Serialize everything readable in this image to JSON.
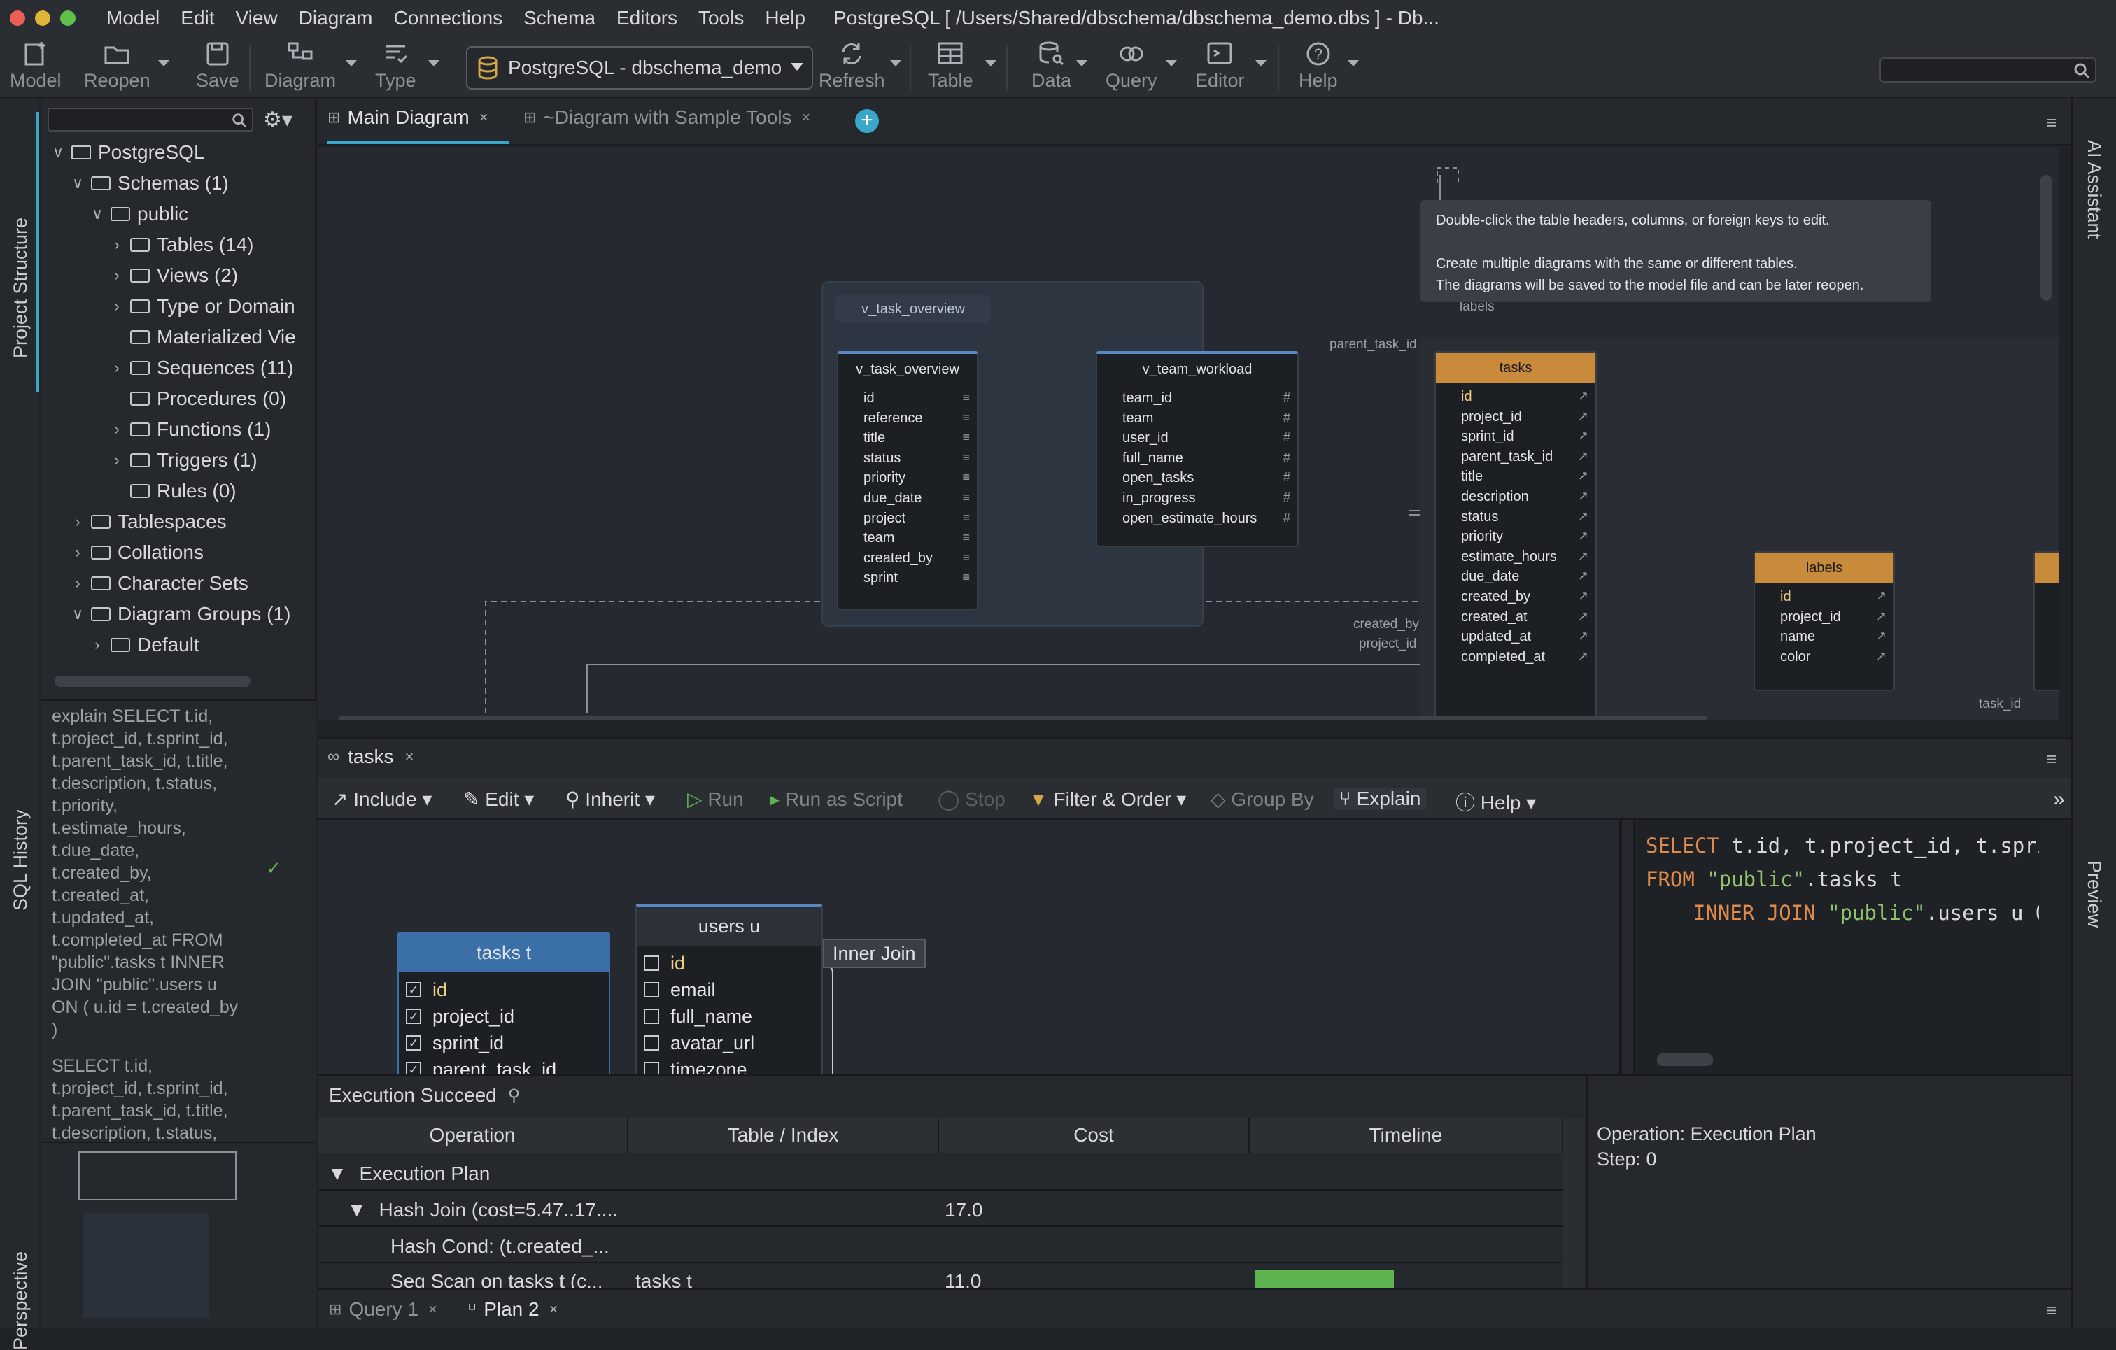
{
  "menubar": {
    "items": [
      "Model",
      "Edit",
      "View",
      "Diagram",
      "Connections",
      "Schema",
      "Editors",
      "Tools",
      "Help"
    ],
    "title": "PostgreSQL [ /Users/Shared/dbschema/dbschema_demo.dbs ] - Db..."
  },
  "toolbar": {
    "model": "Model",
    "reopen": "Reopen",
    "save": "Save",
    "diagram": "Diagram",
    "type": "Type",
    "connection": "PostgreSQL - dbschema_demo",
    "refresh": "Refresh",
    "table": "Table",
    "data": "Data",
    "query": "Query",
    "editor": "Editor",
    "help": "Help"
  },
  "side_tabs": {
    "project_structure": "Project Structure",
    "sql_history": "SQL History",
    "perspective": "Perspective",
    "ai_assistant": "AI Assistant",
    "preview": "Preview"
  },
  "tree": {
    "root": "PostgreSQL",
    "schemas": "Schemas (1)",
    "public": "public",
    "tables": "Tables (14)",
    "views": "Views (2)",
    "types": "Type or Domain",
    "mviews": "Materialized Vie",
    "sequences": "Sequences (11)",
    "procedures": "Procedures (0)",
    "functions": "Functions (1)",
    "triggers": "Triggers (1)",
    "rules": "Rules (0)",
    "tablespaces": "Tablespaces",
    "collations": "Collations",
    "charsets": "Character Sets",
    "diagram_groups": "Diagram Groups (1)",
    "default": "Default"
  },
  "sql_history": {
    "entry1": "explain SELECT t.id,\nt.project_id, t.sprint_id,\nt.parent_task_id, t.title,\nt.description, t.status,\nt.priority,\nt.estimate_hours,\nt.due_date,\nt.created_by,\nt.created_at,\nt.updated_at,\nt.completed_at FROM\n\"public\".tasks t INNER\nJOIN \"public\".users u\nON ( u.id = t.created_by\n)",
    "entry2": "SELECT t.id,\nt.project_id, t.sprint_id,\nt.parent_task_id, t.title,\nt.description, t.status,"
  },
  "diagram_tabs": {
    "main": "Main Diagram",
    "sample": "~Diagram with Sample Tools"
  },
  "canvas": {
    "group_label": "v_task_overview",
    "hint": [
      "Double-click the table headers, columns, or foreign keys to edit.",
      "",
      "Create multiple diagrams with the same or different tables.",
      "The diagrams will be saved to the model file and can be later reopen."
    ],
    "fk_labels": {
      "parent_task_id": "parent_task_id",
      "created_by": "created_by",
      "project_id": "project_id",
      "labels": "labels",
      "task_id": "task_id"
    },
    "v_task_overview": {
      "name": "v_task_overview",
      "columns": [
        "id",
        "reference",
        "title",
        "status",
        "priority",
        "due_date",
        "project",
        "team",
        "created_by",
        "sprint"
      ]
    },
    "v_team_workload": {
      "name": "v_team_workload",
      "columns": [
        "team_id",
        "team",
        "user_id",
        "full_name",
        "open_tasks",
        "in_progress",
        "open_estimate_hours"
      ]
    },
    "tasks": {
      "name": "tasks",
      "columns": [
        "id",
        "project_id",
        "sprint_id",
        "parent_task_id",
        "title",
        "description",
        "status",
        "priority",
        "estimate_hours",
        "due_date",
        "created_by",
        "created_at",
        "updated_at",
        "completed_at"
      ]
    },
    "labels": {
      "name": "labels",
      "columns": [
        "id",
        "project_id",
        "name",
        "color"
      ]
    }
  },
  "query_tab": "tasks",
  "query_toolbar": {
    "include": "Include",
    "edit": "Edit",
    "inherit": "Inherit",
    "run": "Run",
    "run_script": "Run as Script",
    "stop": "Stop",
    "filter": "Filter & Order",
    "group": "Group By",
    "explain": "Explain",
    "help": "Help"
  },
  "builder": {
    "tasks_t": {
      "name": "tasks t",
      "columns": [
        "id",
        "project_id",
        "sprint_id",
        "parent_task_id"
      ]
    },
    "users_u": {
      "name": "users u",
      "columns": [
        "id",
        "email",
        "full_name",
        "avatar_url",
        "timezone"
      ]
    },
    "join": "Inner Join"
  },
  "sql": {
    "kw1": "SELECT",
    "l1": " t.id, t.project_id, t.spri",
    "kw2": "FROM",
    "s2": " \"public\"",
    "l2": ".tasks t",
    "kw3": "INNER JOIN",
    "s3": " \"public\"",
    "l3": ".users u O"
  },
  "results": {
    "status": "Execution Succeed",
    "headers": [
      "Operation",
      "Table / Index",
      "Cost",
      "Timeline"
    ],
    "rows": [
      {
        "op": "Execution Plan",
        "table": "",
        "cost": ""
      },
      {
        "op": "Hash Join  (cost=5.47..17....",
        "table": "",
        "cost": "17.0"
      },
      {
        "op": "Hash Cond: (t.created_...",
        "table": "",
        "cost": ""
      },
      {
        "op": "Seq Scan on tasks t  (c...",
        "table": "tasks t",
        "cost": "11.0"
      }
    ],
    "detail_op": "Operation: Execution Plan",
    "detail_step": "Step: 0",
    "timeline_fraction": 0.45
  },
  "bottom_tabs": {
    "query1": "Query 1",
    "plan2": "Plan 2"
  },
  "colors": {
    "accent": "#3aa6c9",
    "orange_header": "#c98a3c",
    "blue_header": "#3a6fa8",
    "green_bar": "#5fb34f"
  }
}
